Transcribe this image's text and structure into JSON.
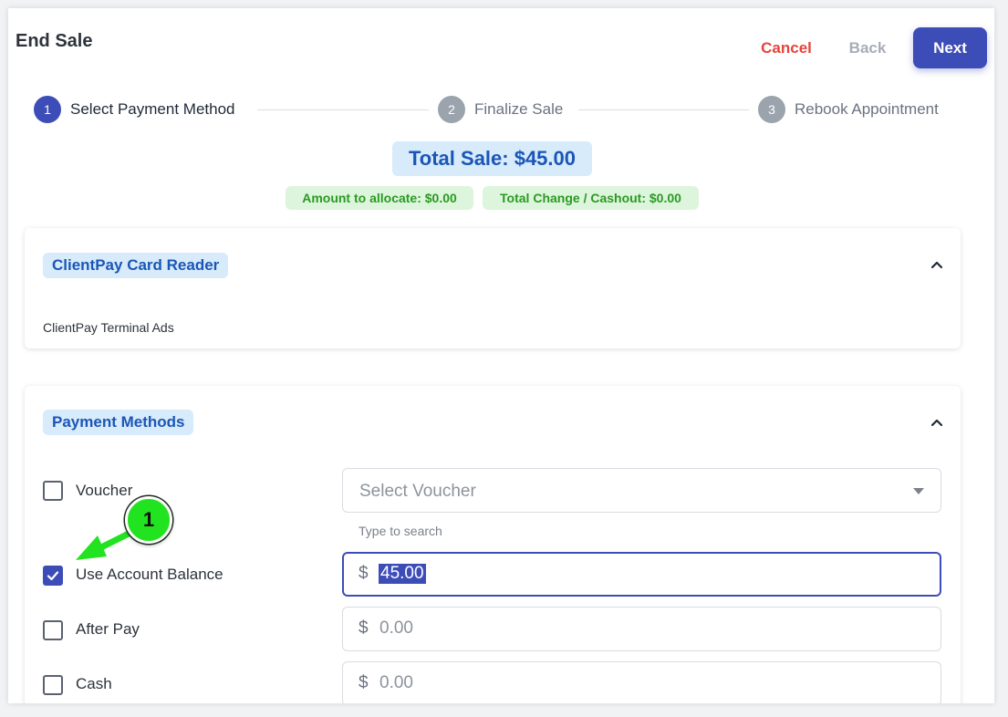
{
  "header": {
    "title": "End Sale",
    "cancel_label": "Cancel",
    "back_label": "Back",
    "next_label": "Next"
  },
  "steps": [
    {
      "number": "1",
      "label": "Select Payment Method",
      "state": "active"
    },
    {
      "number": "2",
      "label": "Finalize Sale",
      "state": "inactive"
    },
    {
      "number": "3",
      "label": "Rebook Appointment",
      "state": "inactive"
    }
  ],
  "summary": {
    "total_sale": "Total Sale: $45.00",
    "amount_to_allocate": "Amount to allocate: $0.00",
    "total_change": "Total Change / Cashout: $0.00"
  },
  "card_reader": {
    "title": "ClientPay Card Reader",
    "description": "ClientPay Terminal Ads",
    "icon": "chevron-up-icon"
  },
  "payment_methods": {
    "title": "Payment Methods",
    "icon": "chevron-up-icon",
    "voucher": {
      "label": "Voucher",
      "checked": false,
      "select_placeholder": "Select Voucher",
      "helper_text": "Type to search"
    },
    "account_balance": {
      "label": "Use Account Balance",
      "checked": true,
      "currency": "$",
      "value": "45.00"
    },
    "after_pay": {
      "label": "After Pay",
      "checked": false,
      "currency": "$",
      "placeholder": "0.00"
    },
    "cash": {
      "label": "Cash",
      "checked": false,
      "currency": "$",
      "placeholder": "0.00"
    }
  },
  "annotation": {
    "marker_number": "1",
    "marker_color": "#22e31f"
  },
  "colors": {
    "primary": "#3d4db7",
    "cancel": "#e5443b",
    "chip_bg": "#d7ebfb",
    "chip_text": "#1b56b6",
    "success_bg": "#ddf5dc",
    "success_text": "#2a9a22"
  }
}
